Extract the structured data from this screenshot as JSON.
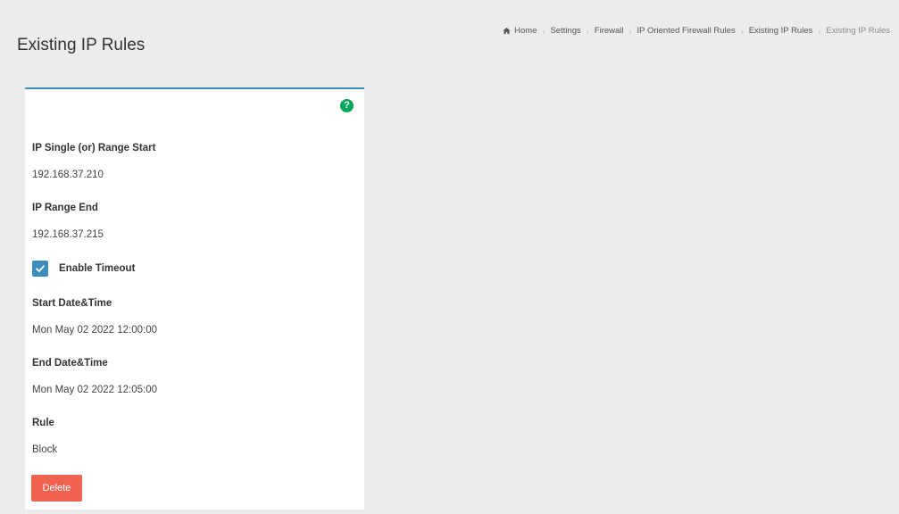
{
  "page": {
    "title": "Existing IP Rules"
  },
  "breadcrumb": {
    "items": [
      "Home",
      "Settings",
      "Firewall",
      "IP Oriented Firewall Rules",
      "Existing IP Rules",
      "Existing IP Rules"
    ],
    "separator": "›"
  },
  "form": {
    "help_icon_glyph": "?",
    "ip_start": {
      "label": "IP Single (or) Range Start",
      "value": "192.168.37.210"
    },
    "ip_end": {
      "label": "IP Range End",
      "value": "192.168.37.215"
    },
    "enable_timeout": {
      "label": "Enable Timeout",
      "checked": true
    },
    "start_datetime": {
      "label": "Start Date&Time",
      "value": "Mon May 02 2022 12:00:00"
    },
    "end_datetime": {
      "label": "End Date&Time",
      "value": "Mon May 02 2022 12:05:00"
    },
    "rule": {
      "label": "Rule",
      "value": "Block"
    },
    "delete_label": "Delete"
  },
  "colors": {
    "accent": "#3c8dbc",
    "help": "#00a65a",
    "danger": "#f0614f",
    "background": "#ececec"
  }
}
